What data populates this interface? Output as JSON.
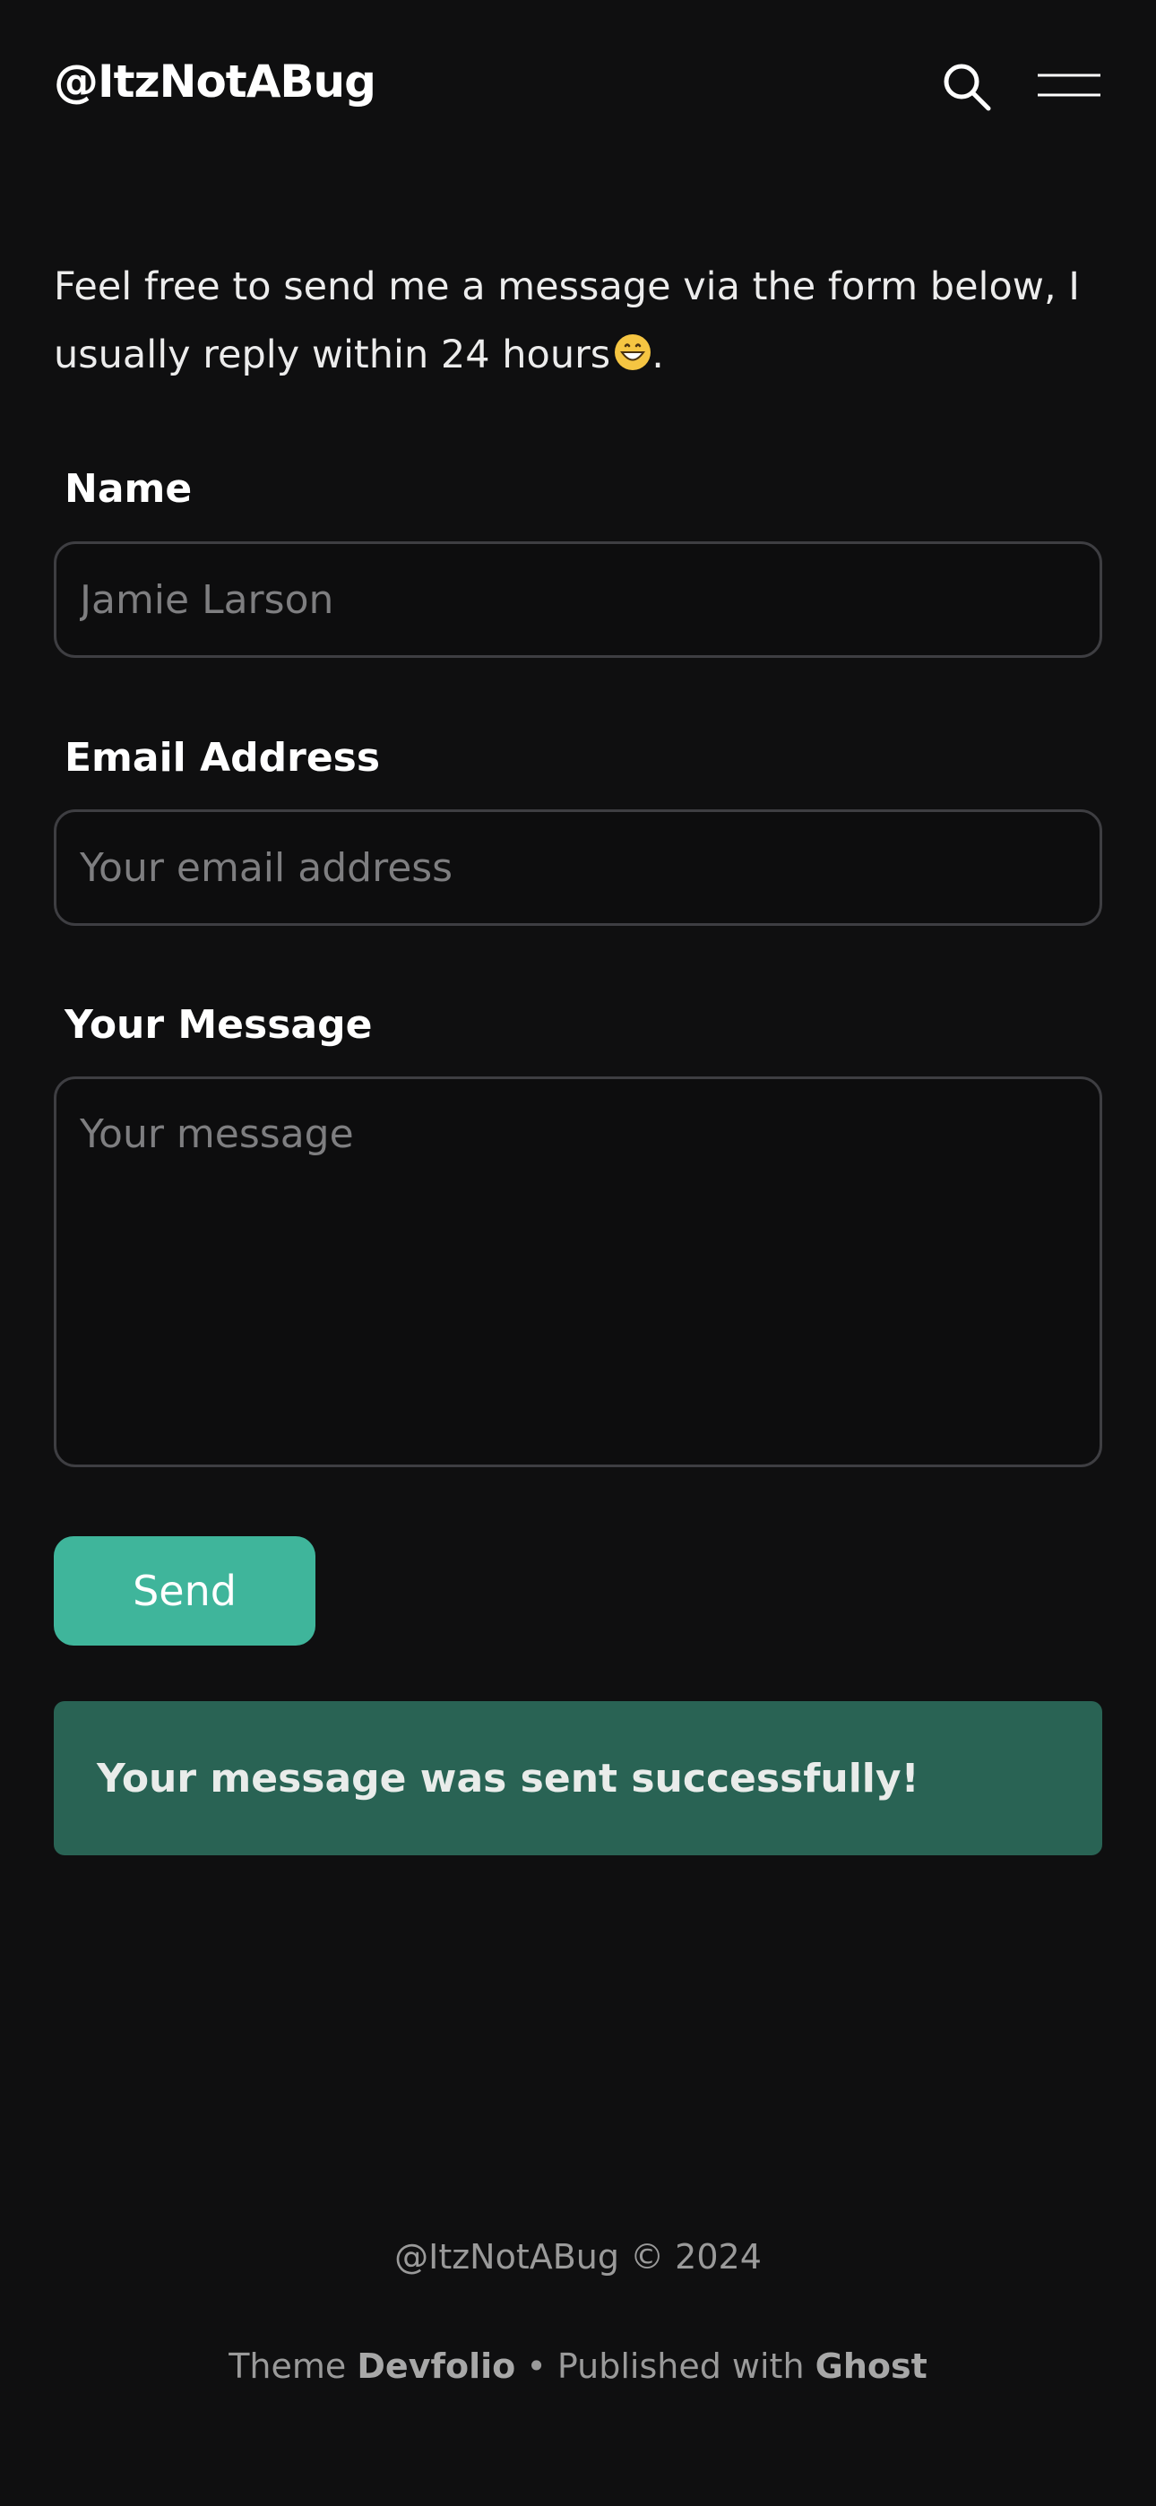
{
  "header": {
    "site_title": "@ItzNotABug",
    "search_icon": "search-icon",
    "menu_icon": "hamburger-menu-icon"
  },
  "intro": {
    "text": "Feel free to send me a message via the form below, I usually reply within 24 hours",
    "emoji": "grinning-face-emoji",
    "suffix": "."
  },
  "form": {
    "name_label": "Name",
    "name_placeholder": "Jamie Larson",
    "email_label": "Email Address",
    "email_placeholder": "Your email address",
    "message_label": "Your Message",
    "message_placeholder": "Your message",
    "send_label": "Send"
  },
  "status": {
    "success_text": "Your message was sent successfully!"
  },
  "footer": {
    "copyright": "@ItzNotABug © 2024",
    "theme_prefix": "Theme",
    "theme_name": "Devfolio",
    "separator": "•",
    "published_prefix": "Published with",
    "platform_name": "Ghost"
  },
  "colors": {
    "background": "#0f0f10",
    "accent": "#3fb59b",
    "success_bg": "#296354"
  }
}
